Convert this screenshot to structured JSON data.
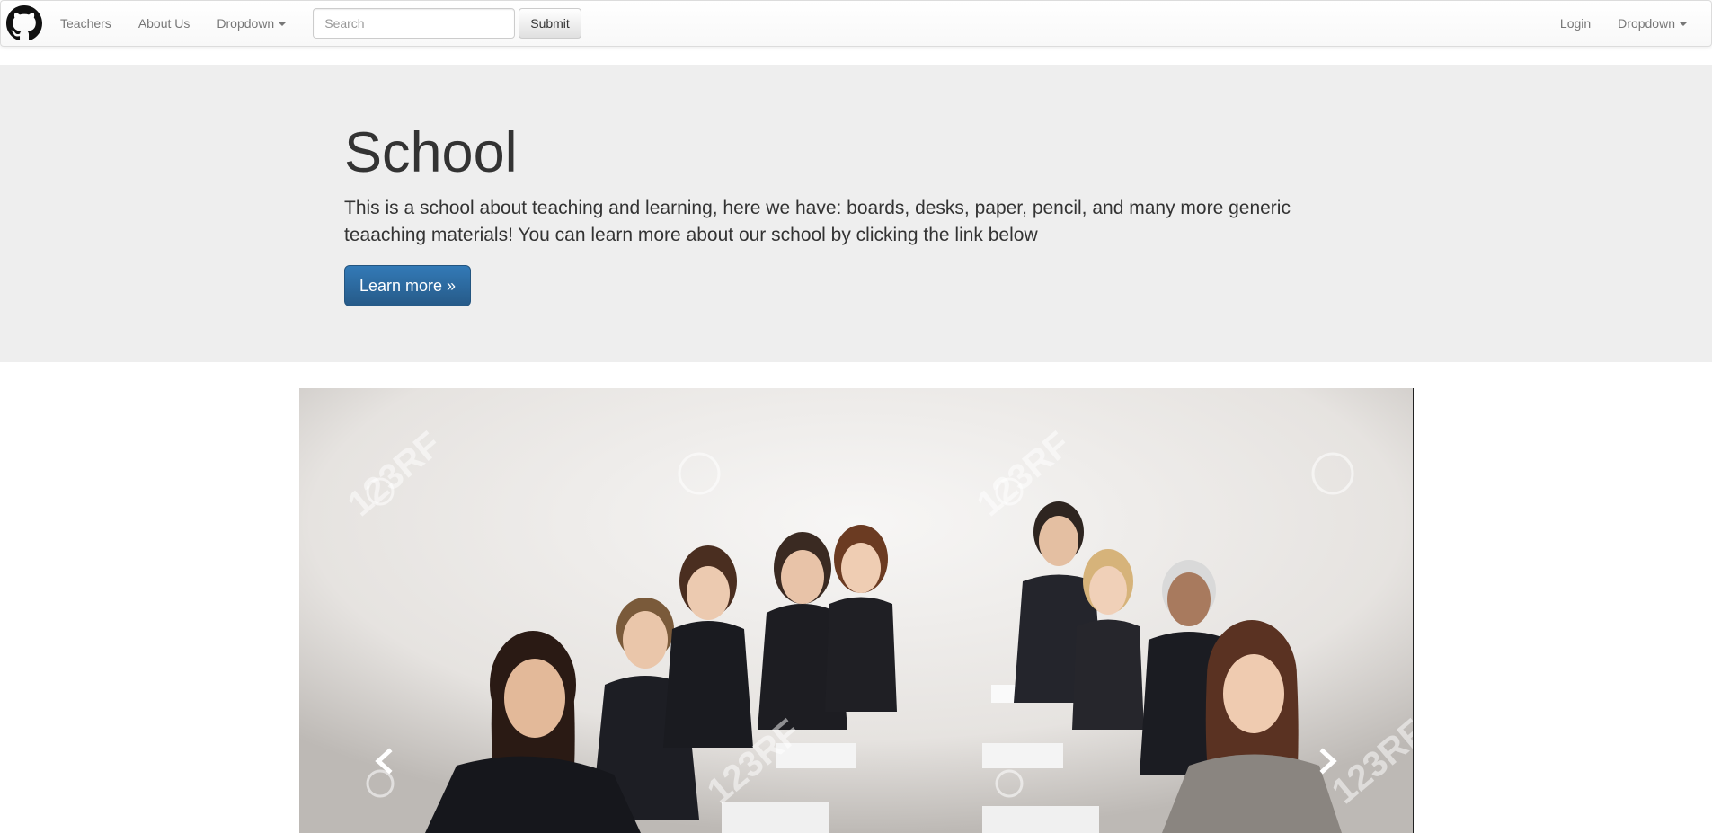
{
  "navbar": {
    "brand_icon": "github-icon",
    "links_left": [
      {
        "label": "Teachers"
      },
      {
        "label": "About Us"
      },
      {
        "label": "Dropdown"
      }
    ],
    "search": {
      "placeholder": "Search",
      "value": ""
    },
    "submit_label": "Submit",
    "links_right": [
      {
        "label": "Login"
      },
      {
        "label": "Dropdown"
      }
    ]
  },
  "jumbotron": {
    "title": "School",
    "text": "This is a school about teaching and learning, here we have: boards, desks, paper, pencil, and many more generic teaaching materials! You can learn more about our school by clicking the link below",
    "button_label": "Learn more »"
  },
  "carousel": {
    "prev_icon": "chevron-left-icon",
    "next_icon": "chevron-right-icon",
    "watermark_text": "123RF"
  },
  "colors": {
    "primary": "#337ab7",
    "jumbotron_bg": "#eeeeee",
    "nav_text": "#777777"
  }
}
